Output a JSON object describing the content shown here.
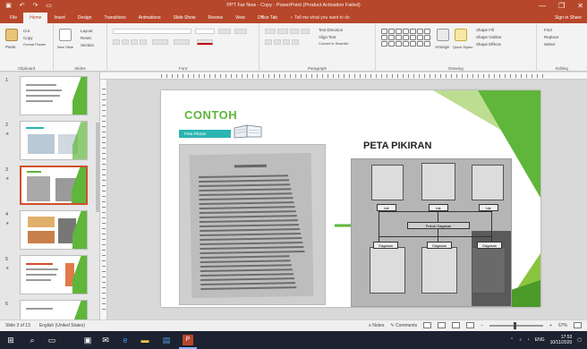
{
  "window": {
    "title": "PPT Far Now - Copy - PowerPoint (Product Activation Failed)",
    "qat_icons": [
      "save-icon",
      "undo-icon",
      "redo-icon",
      "present-icon"
    ],
    "controls": [
      "—",
      "❐",
      "✕"
    ]
  },
  "ribbon": {
    "tabs": [
      {
        "label": "File",
        "active": false
      },
      {
        "label": "Home",
        "active": true
      },
      {
        "label": "Insert",
        "active": false
      },
      {
        "label": "Design",
        "active": false
      },
      {
        "label": "Transitions",
        "active": false
      },
      {
        "label": "Animations",
        "active": false
      },
      {
        "label": "Slide Show",
        "active": false
      },
      {
        "label": "Review",
        "active": false
      },
      {
        "label": "View",
        "active": false
      },
      {
        "label": "Office Tab",
        "active": false
      }
    ],
    "tell_me": "♀ Tell me what you want to do",
    "account": "Sign in  Share",
    "groups": {
      "clipboard": {
        "label": "Clipboard",
        "paste": "Paste",
        "cut": "Cut",
        "copy": "Copy",
        "format_painter": "Format Painter"
      },
      "slides": {
        "label": "Slides",
        "new_slide": "New Slide",
        "layout": "Layout",
        "reset": "Reset",
        "section": "Section"
      },
      "font": {
        "label": "Font"
      },
      "paragraph": {
        "label": "Paragraph",
        "text_direction": "Text Direction",
        "align_text": "Align Text",
        "smartart": "Convert to SmartArt"
      },
      "drawing": {
        "label": "Drawing",
        "arrange": "Arrange",
        "quick_styles": "Quick Styles",
        "shape_fill": "Shape Fill",
        "shape_outline": "Shape Outline",
        "shape_effects": "Shape Effects"
      },
      "editing": {
        "label": "Editing",
        "find": "Find",
        "replace": "Replace",
        "select": "Select"
      }
    }
  },
  "thumbnails": [
    {
      "num": "1",
      "selected": false
    },
    {
      "num": "2",
      "selected": false
    },
    {
      "num": "3",
      "selected": true
    },
    {
      "num": "4",
      "selected": false
    },
    {
      "num": "5",
      "selected": false
    },
    {
      "num": "6",
      "selected": false
    }
  ],
  "slide": {
    "heading": "CONTOH",
    "badge": "Peta Pikiran",
    "map_title": "PETA PIKIRAN",
    "map_labels": [
      "Ide",
      "Ide",
      "Ide",
      "Pokok Gagasan",
      "Gagasan",
      "Gagasan",
      "Gagasan"
    ]
  },
  "status": {
    "slide_info": "Slide 3 of 13",
    "language": "English (United States)",
    "notes": "≡ Notes",
    "comments": "✎ Comments",
    "zoom_minus": "−",
    "zoom_plus": "+",
    "zoom": "67%"
  },
  "taskbar": {
    "start_icon": "windows-start-icon",
    "apps": [
      "search-icon",
      "task-view-icon",
      "store-icon",
      "mail-icon",
      "edge-icon",
      "explorer-icon",
      "photos-icon",
      "powerpoint-icon"
    ],
    "time": "17:53",
    "date": "10/11/2020",
    "lang": "ENG"
  },
  "colors": {
    "accent": "#b7472a",
    "green": "#5fb63a",
    "teal": "#2ab5b1"
  }
}
